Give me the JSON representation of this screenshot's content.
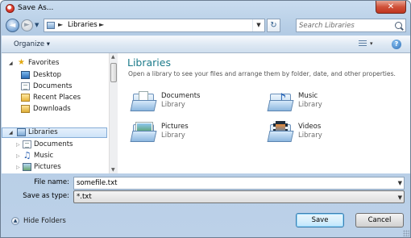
{
  "window": {
    "title": "Save As...",
    "close_glyph": "✕"
  },
  "nav": {
    "back_glyph": "◄",
    "forward_glyph": "►",
    "dropdown_glyph": "▼",
    "address": {
      "crumbs": [
        "Libraries"
      ],
      "sep": "►",
      "dropdown_glyph": "▼"
    },
    "refresh_glyph": "↻",
    "search_placeholder": "Search Libraries"
  },
  "toolbar": {
    "organize_label": "Organize ▾",
    "view_dd": "▾",
    "help_glyph": "?"
  },
  "sidebar": {
    "items": [
      {
        "label": "Favorites",
        "expander": "◢",
        "icon": "star-icon"
      },
      {
        "label": "Desktop",
        "icon": "desktop-icon"
      },
      {
        "label": "Documents",
        "icon": "documents-icon"
      },
      {
        "label": "Recent Places",
        "icon": "recent-places-icon"
      },
      {
        "label": "Downloads",
        "icon": "downloads-icon"
      },
      {
        "label": "Libraries",
        "expander": "◢",
        "icon": "libraries-icon",
        "selected": true
      },
      {
        "label": "Documents",
        "expander": "▷",
        "icon": "documents-icon"
      },
      {
        "label": "Music",
        "expander": "▷",
        "icon": "music-icon"
      },
      {
        "label": "Pictures",
        "expander": "▷",
        "icon": "pictures-icon"
      }
    ],
    "scroll_up": "▲",
    "scroll_down": "▼"
  },
  "content": {
    "title": "Libraries",
    "description": "Open a library to see your files and arrange them by folder, date, and other properties.",
    "libraries": [
      {
        "name": "Documents",
        "type": "Library",
        "icon": "documents-library-icon"
      },
      {
        "name": "Music",
        "type": "Library",
        "icon": "music-library-icon"
      },
      {
        "name": "Pictures",
        "type": "Library",
        "icon": "pictures-library-icon"
      },
      {
        "name": "Videos",
        "type": "Library",
        "icon": "videos-library-icon"
      }
    ]
  },
  "form": {
    "file_name_label": "File name:",
    "file_name_value": "somefile.txt",
    "save_type_label": "Save as type:",
    "save_type_value": "*.txt",
    "dd_glyph": "▼"
  },
  "footer": {
    "hide_folders_label": "Hide Folders",
    "hide_glyph": "▲",
    "save_label": "Save",
    "cancel_label": "Cancel"
  },
  "colors": {
    "accent_title": "#1b7a8a",
    "selection": "#cde3f8",
    "close_button": "#c0351f"
  }
}
